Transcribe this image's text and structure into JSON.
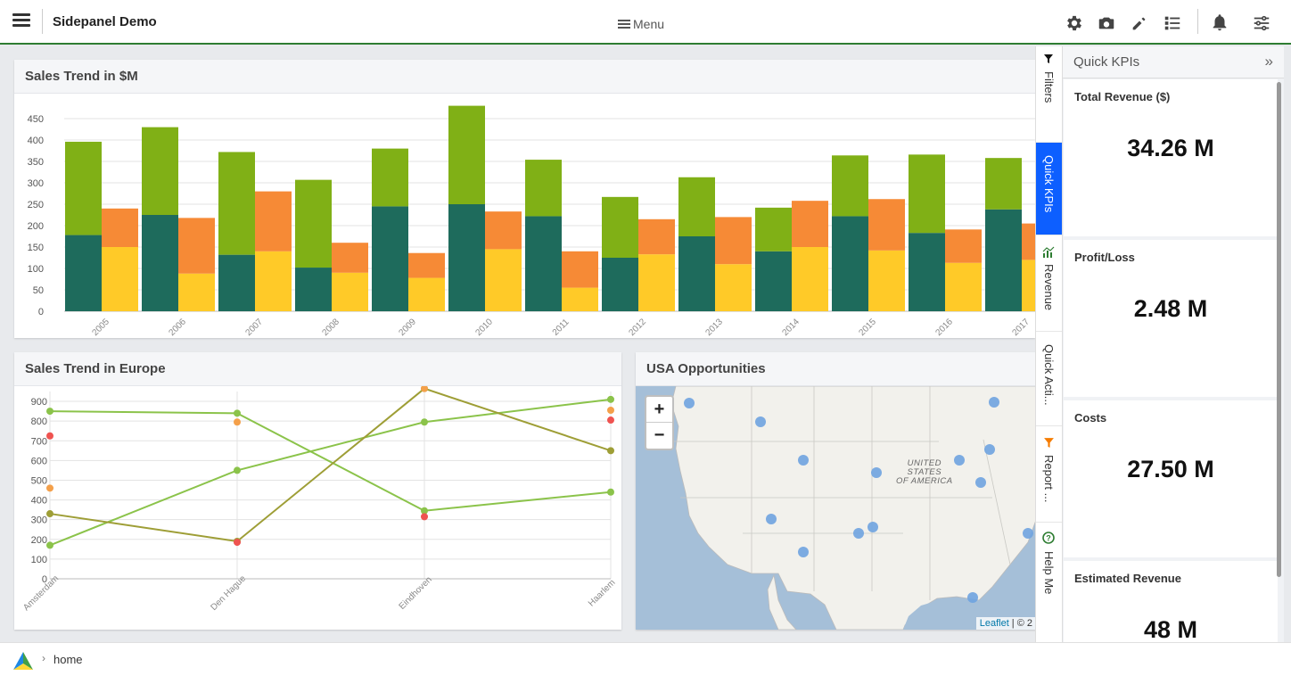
{
  "app": {
    "title": "Sidepanel Demo",
    "menu_label": "Menu"
  },
  "toolbar_icons": [
    "gear-icon",
    "camera-icon",
    "pencil-icon",
    "list-icon",
    "bell-icon",
    "sliders-icon"
  ],
  "sales_chart": {
    "title": "Sales Trend in $M",
    "chart_data": {
      "type": "bar",
      "stacked": "two stacks per category",
      "categories": [
        "2005",
        "2006",
        "2007",
        "2008",
        "2009",
        "2010",
        "2011",
        "2012",
        "2013",
        "2014",
        "2015",
        "2016",
        "2017"
      ],
      "ylim": [
        0,
        450
      ],
      "yticks": [
        0,
        50,
        100,
        150,
        200,
        250,
        300,
        350,
        400,
        450
      ],
      "series": [
        {
          "stack": "A",
          "color": "#1e6b5c",
          "values": [
            178,
            225,
            132,
            102,
            245,
            250,
            222,
            125,
            175,
            140,
            222,
            183,
            238
          ]
        },
        {
          "stack": "A",
          "color": "#80b016",
          "values": [
            218,
            205,
            240,
            205,
            135,
            230,
            132,
            142,
            138,
            102,
            142,
            183,
            120
          ]
        },
        {
          "stack": "B",
          "color": "#ffca28",
          "values": [
            150,
            88,
            140,
            90,
            78,
            145,
            55,
            133,
            110,
            150,
            142,
            113,
            120
          ]
        },
        {
          "stack": "B",
          "color": "#f68a36",
          "values": [
            90,
            130,
            140,
            70,
            58,
            88,
            85,
            82,
            110,
            108,
            120,
            78,
            85
          ]
        }
      ]
    }
  },
  "europe_chart": {
    "title": "Sales Trend in Europe",
    "chart_data": {
      "type": "line",
      "categories": [
        "Amsterdam",
        "Den Hague",
        "Eindhoven",
        "Haarlem"
      ],
      "ylim": [
        0,
        950
      ],
      "yticks": [
        0,
        100,
        200,
        300,
        400,
        500,
        600,
        700,
        800,
        900
      ],
      "series": [
        {
          "color": "#8bc34a",
          "values": [
            850,
            840,
            345,
            440
          ]
        },
        {
          "color": "#8bc34a",
          "values": [
            170,
            550,
            795,
            910
          ]
        },
        {
          "color": "#9e9e36",
          "values": [
            330,
            190,
            965,
            650
          ]
        }
      ],
      "points": [
        {
          "color": "#ef5350",
          "values": [
            725,
            185,
            315,
            805
          ]
        },
        {
          "color": "#f4a04a",
          "values": [
            460,
            795,
            965,
            855
          ]
        }
      ]
    }
  },
  "map": {
    "title": "USA Opportunities",
    "zoom_in": "+",
    "zoom_out": "−",
    "attribution_link": "Leaflet",
    "attribution_rest": " | © 2",
    "country_label_1": "UNITED",
    "country_label_2": "STATES",
    "country_label_3": "OF AMERICA"
  },
  "side_tabs": [
    {
      "label": "Filters",
      "icon": "funnel-icon"
    },
    {
      "label": "Quick KPIs",
      "icon": ""
    },
    {
      "label": "Revenue",
      "icon": "chart-icon"
    },
    {
      "label": "Quick Acti...",
      "icon": ""
    },
    {
      "label": "Report ...",
      "icon": "funnel-icon"
    },
    {
      "label": "Help Me",
      "icon": "help-icon"
    }
  ],
  "kpi_panel": {
    "title": "Quick KPIs",
    "collapse": "»",
    "items": [
      {
        "label": "Total Revenue ($)",
        "value": "34.26 M"
      },
      {
        "label": "Profit/Loss",
        "value": "2.48 M"
      },
      {
        "label": "Costs",
        "value": "27.50 M"
      },
      {
        "label": "Estimated Revenue",
        "value": "48 M"
      }
    ]
  },
  "footer": {
    "breadcrumb": "home"
  },
  "colors": {
    "accent_border": "#2e7d32",
    "active_tab": "#0d5fff"
  }
}
